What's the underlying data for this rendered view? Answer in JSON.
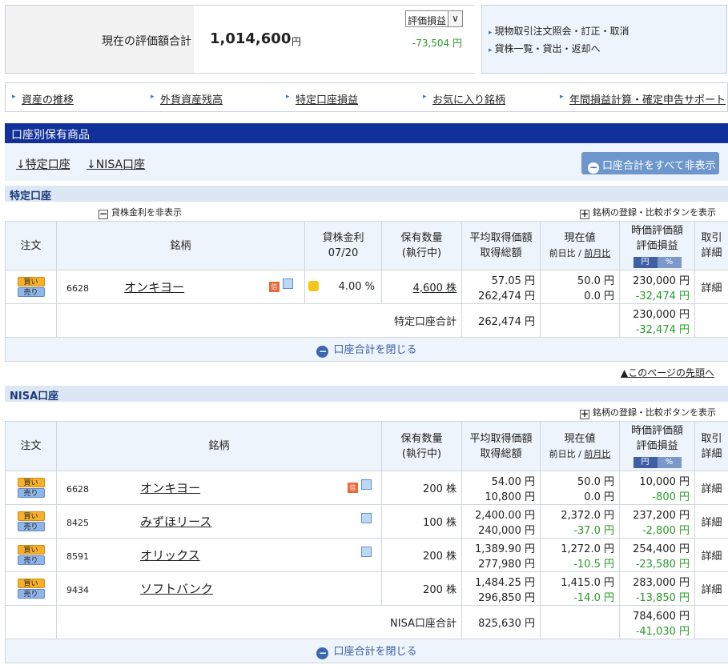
{
  "summary": {
    "label": "現在の評価額合計",
    "amount": "1,014,600",
    "unit": "円",
    "select_value": "評価損益",
    "profit_loss": "-73,504 円"
  },
  "side_links": [
    "現物取引注文照会・訂正・取消",
    "貸株一覧・貸出・返却へ"
  ],
  "nav": [
    "資産の推移",
    "外貨資産残高",
    "特定口座損益",
    "お気に入り銘柄",
    "年間損益計算・確定申告サポート"
  ],
  "section_title": "口座別保有商品",
  "account_tabs": [
    "↓特定口座",
    "↓NISA口座"
  ],
  "hide_all_label": "口座合計をすべて非表示",
  "tokutei": {
    "title": "特定口座",
    "lending_toggle": "貸株金利を非表示",
    "compare_toggle": "銘柄の登録・比較ボタンを表示",
    "headers": {
      "order": "注文",
      "name": "銘柄",
      "lend1": "貸株金利",
      "lend2": "07/20",
      "qty1": "保有数量",
      "qty2": "(執行中)",
      "avg1": "平均取得価額",
      "avg2": "取得総額",
      "price1": "現在値",
      "price2a": "前日比",
      "price2b": "前月比",
      "val1": "時価評価額",
      "val2": "評価損益",
      "yen": "円",
      "pct": "%",
      "det1": "取引",
      "det2": "詳細"
    },
    "rows": [
      {
        "buy": "買い",
        "sell": "売り",
        "code": "6628",
        "name": "オンキヨー",
        "rate": "4.00 %",
        "qty": "4,600 株",
        "avg": "57.05 円",
        "total": "262,474 円",
        "price": "50.0 円",
        "change": "0.0 円",
        "value": "230,000 円",
        "pl": "-32,474 円",
        "detail": "詳細"
      }
    ],
    "total_label": "特定口座合計",
    "total_cost": "262,474 円",
    "total_value": "230,000 円",
    "total_pl": "-32,474 円",
    "close_label": "口座合計を閉じる"
  },
  "pagetop": "▲このページの先頭へ",
  "nisa": {
    "title": "NISA口座",
    "compare_toggle": "銘柄の登録・比較ボタンを表示",
    "headers": {
      "order": "注文",
      "name": "銘柄",
      "qty1": "保有数量",
      "qty2": "(執行中)",
      "avg1": "平均取得価額",
      "avg2": "取得総額",
      "price1": "現在値",
      "price2a": "前日比",
      "price2b": "前月比",
      "val1": "時価評価額",
      "val2": "評価損益",
      "yen": "円",
      "pct": "%",
      "det1": "取引",
      "det2": "詳細"
    },
    "rows": [
      {
        "buy": "買い",
        "sell": "売り",
        "code": "6628",
        "name": "オンキヨー",
        "qty": "200 株",
        "avg": "54.00 円",
        "total": "10,800 円",
        "price": "50.0 円",
        "change": "0.0 円",
        "value": "10,000 円",
        "pl": "-800 円",
        "detail": "詳細"
      },
      {
        "buy": "買い",
        "sell": "売り",
        "code": "8425",
        "name": "みずほリース",
        "qty": "100 株",
        "avg": "2,400.00 円",
        "total": "240,000 円",
        "price": "2,372.0 円",
        "change": "-37.0 円",
        "value": "237,200 円",
        "pl": "-2,800 円",
        "detail": "詳細"
      },
      {
        "buy": "買い",
        "sell": "売り",
        "code": "8591",
        "name": "オリックス",
        "qty": "200 株",
        "avg": "1,389.90 円",
        "total": "277,980 円",
        "price": "1,272.0 円",
        "change": "-10.5 円",
        "value": "254,400 円",
        "pl": "-23,580 円",
        "detail": "詳細"
      },
      {
        "buy": "買い",
        "sell": "売り",
        "code": "9434",
        "name": "ソフトバンク",
        "qty": "200 株",
        "avg": "1,484.25 円",
        "total": "296,850 円",
        "price": "1,415.0 円",
        "change": "-14.0 円",
        "value": "283,000 円",
        "pl": "-13,850 円",
        "detail": "詳細"
      }
    ],
    "total_label": "NISA口座合計",
    "total_cost": "825,630 円",
    "total_value": "784,600 円",
    "total_pl": "-41,030 円",
    "close_label": "口座合計を閉じる"
  }
}
